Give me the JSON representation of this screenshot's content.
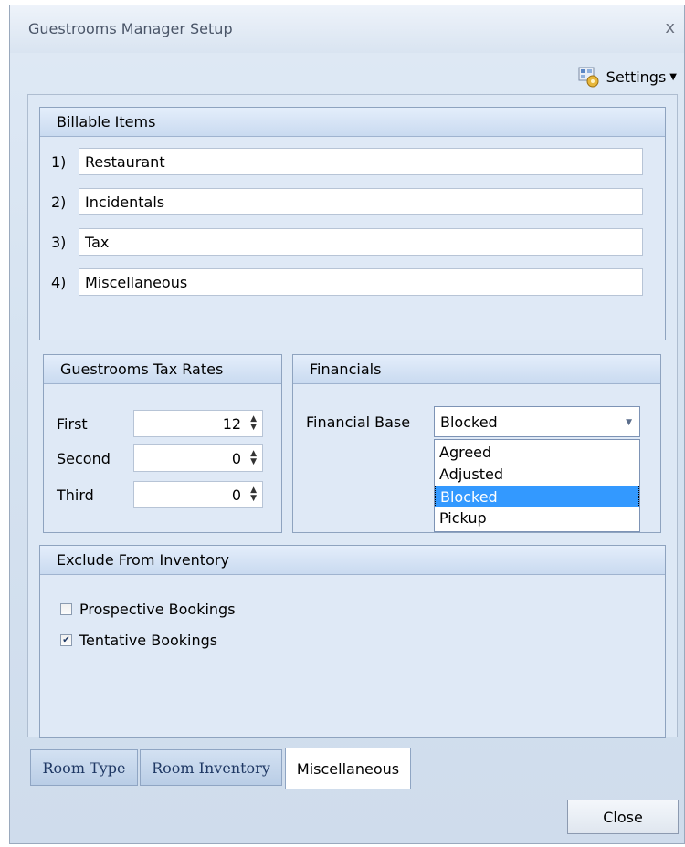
{
  "window": {
    "title": "Guestrooms Manager Setup",
    "close_glyph": "x"
  },
  "toolbar": {
    "settings_label": "Settings",
    "settings_icon": "settings-icon"
  },
  "billable_items": {
    "heading": "Billable Items",
    "items": [
      {
        "num": "1)",
        "value": "Restaurant"
      },
      {
        "num": "2)",
        "value": "Incidentals"
      },
      {
        "num": "3)",
        "value": "Tax"
      },
      {
        "num": "4)",
        "value": "Miscellaneous"
      }
    ]
  },
  "tax_rates": {
    "heading": "Guestrooms Tax Rates",
    "rows": [
      {
        "label": "First",
        "value": "12"
      },
      {
        "label": "Second",
        "value": "0"
      },
      {
        "label": "Third",
        "value": "0"
      }
    ]
  },
  "financials": {
    "heading": "Financials",
    "base_label": "Financial Base",
    "selected": "Blocked",
    "options": [
      "Agreed",
      "Adjusted",
      "Blocked",
      "Pickup"
    ]
  },
  "exclude": {
    "heading": "Exclude From Inventory",
    "options": [
      {
        "label": "Prospective Bookings",
        "checked": false
      },
      {
        "label": "Tentative Bookings",
        "checked": true
      }
    ]
  },
  "tabs": [
    {
      "label": "Room Type",
      "active": false
    },
    {
      "label": "Room Inventory",
      "active": false
    },
    {
      "label": "Miscellaneous",
      "active": true
    }
  ],
  "footer": {
    "close_label": "Close"
  },
  "colors": {
    "selection": "#3399ff",
    "header_bg": "#c9daf0"
  }
}
